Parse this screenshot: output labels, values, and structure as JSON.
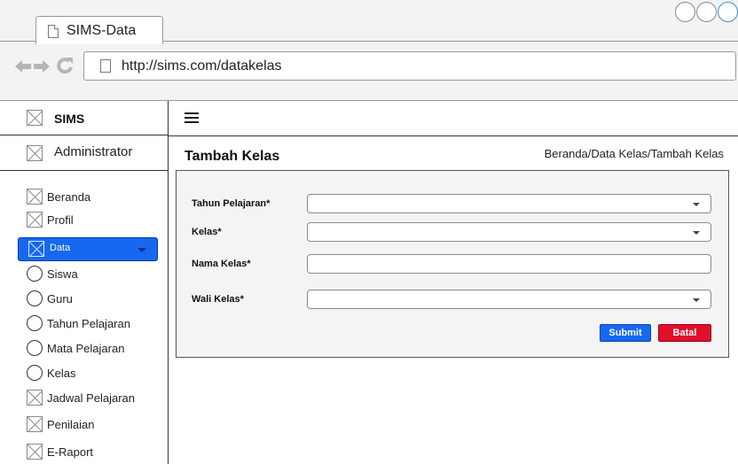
{
  "browser": {
    "tab_title": "SIMS-Data",
    "url": "http://sims.com/datakelas"
  },
  "sidebar": {
    "brand": "SIMS",
    "user": "Administrator",
    "items": [
      {
        "label": "Beranda",
        "icon": "placeholder-image-icon"
      },
      {
        "label": "Profil",
        "icon": "placeholder-image-icon"
      },
      {
        "label": "Data",
        "icon": "placeholder-image-icon",
        "active": true
      },
      {
        "label": "Siswa",
        "icon": "circle-icon"
      },
      {
        "label": "Guru",
        "icon": "circle-icon"
      },
      {
        "label": "Tahun Pelajaran",
        "icon": "circle-icon"
      },
      {
        "label": "Mata Pelajaran",
        "icon": "circle-icon"
      },
      {
        "label": "Kelas",
        "icon": "circle-icon"
      },
      {
        "label": "Jadwal Pelajaran",
        "icon": "placeholder-image-icon"
      },
      {
        "label": "Penilaian",
        "icon": "placeholder-image-icon"
      },
      {
        "label": "E-Raport",
        "icon": "placeholder-image-icon"
      }
    ]
  },
  "main": {
    "title": "Tambah Kelas",
    "breadcrumb": "Beranda/Data Kelas/Tambah Kelas"
  },
  "form": {
    "tahun_pelajaran_label": "Tahun Pelajaran*",
    "tahun_pelajaran_value": "",
    "kelas_label": "Kelas*",
    "kelas_value": "",
    "nama_kelas_label": "Nama Kelas*",
    "nama_kelas_value": "",
    "wali_kelas_label": "Wali Kelas*",
    "wali_kelas_value": "",
    "submit_label": "Submit",
    "cancel_label": "Batal"
  },
  "colors": {
    "primary": "#1668f0",
    "danger": "#e0102c"
  }
}
